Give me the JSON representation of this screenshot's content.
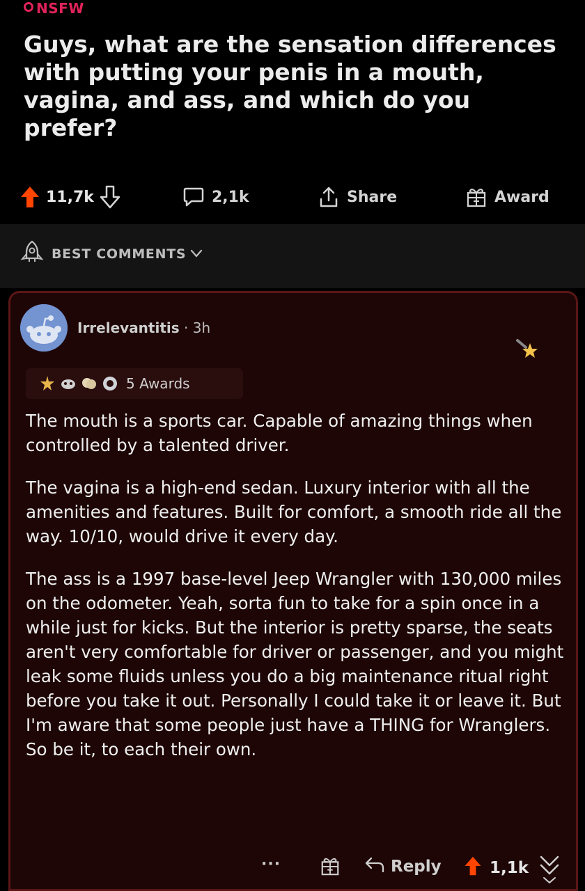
{
  "post": {
    "badge": "NSFW",
    "title": "Guys, what are the sensation differences with putting your penis in a mouth, vagina, and ass, and which do you prefer?",
    "score": "11,7k",
    "comments": "2,1k",
    "share_label": "Share",
    "award_label": "Award"
  },
  "sort": {
    "label": "BEST COMMENTS"
  },
  "comment": {
    "username": "Irrelevantitis",
    "separator": " · ",
    "time": "3h",
    "awards_label": "5 Awards",
    "paragraphs": [
      "The mouth is a sports car. Capable of amazing things when controlled by a talented driver.",
      "The vagina is a high-end sedan. Luxury interior with all the amenities and features. Built for comfort, a smooth ride all the way.  10/10, would drive it every day.",
      "The ass is a 1997 base-level Jeep Wrangler with 130,000 miles on the odometer. Yeah, sorta fun to take for a spin once in a while just for kicks. But the interior is pretty sparse, the seats aren't very comfortable for driver or passenger, and you might leak some fluids unless you do a big maintenance ritual right before you take it out. Personally I could take it or leave it. But I'm aware that some people just have a THING for Wranglers. So be it, to each their own."
    ],
    "more": "···",
    "reply_label": "Reply",
    "score": "1,1k"
  },
  "icons": {
    "nsfw": "nsfw-circle-icon",
    "upvote": "upvote-arrow-icon",
    "downvote": "downvote-arrow-icon",
    "comment": "comment-bubble-icon",
    "share": "share-icon",
    "award": "gift-box-icon",
    "sort": "rocket-icon",
    "reply": "reply-arrow-icon",
    "scroll": "double-chevron-down-icon"
  },
  "colors": {
    "upvote": "#ff4500",
    "nsfw": "#e0235a",
    "card_bg": "#1e0606",
    "card_border": "#5a1616"
  }
}
